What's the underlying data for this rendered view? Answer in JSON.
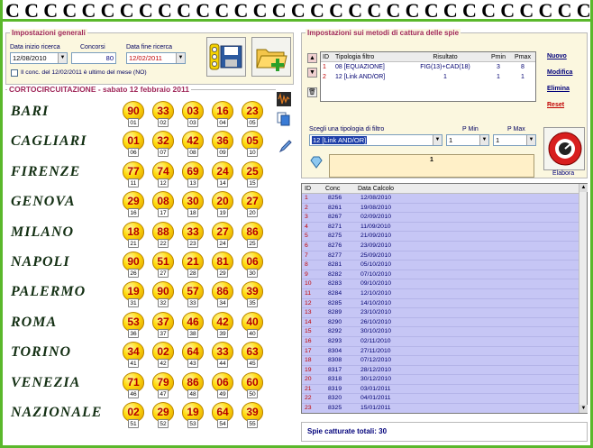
{
  "header": {
    "ring_glyph": "C"
  },
  "generali": {
    "title": "Impostazioni generali",
    "data_inizio_label": "Data inizio ricerca",
    "data_inizio_value": "12/08/2010",
    "concorsi_label": "Concorsi",
    "concorsi_value": "80",
    "data_fine_label": "Data fine ricerca",
    "data_fine_value": "12/02/2011",
    "checkbox_label": "Il conc. del 12/02/2011 è ultimo del mese (NO)"
  },
  "corto": {
    "title": "CORTOCIRCUITAZIONE - sabato 12 febbraio 2011",
    "wheels": [
      {
        "name": "BARI",
        "balls": [
          [
            "90",
            "01"
          ],
          [
            "33",
            "02"
          ],
          [
            "03",
            "03"
          ],
          [
            "16",
            "04"
          ],
          [
            "23",
            "05"
          ]
        ]
      },
      {
        "name": "CAGLIARI",
        "balls": [
          [
            "01",
            "06"
          ],
          [
            "32",
            "07"
          ],
          [
            "42",
            "08"
          ],
          [
            "36",
            "09"
          ],
          [
            "05",
            "10"
          ]
        ]
      },
      {
        "name": "FIRENZE",
        "balls": [
          [
            "77",
            "11"
          ],
          [
            "74",
            "12"
          ],
          [
            "69",
            "13"
          ],
          [
            "24",
            "14"
          ],
          [
            "25",
            "15"
          ]
        ]
      },
      {
        "name": "GENOVA",
        "balls": [
          [
            "29",
            "16"
          ],
          [
            "08",
            "17"
          ],
          [
            "30",
            "18"
          ],
          [
            "20",
            "19"
          ],
          [
            "27",
            "20"
          ]
        ]
      },
      {
        "name": "MILANO",
        "balls": [
          [
            "18",
            "21"
          ],
          [
            "88",
            "22"
          ],
          [
            "33",
            "23"
          ],
          [
            "27",
            "24"
          ],
          [
            "86",
            "25"
          ]
        ]
      },
      {
        "name": "NAPOLI",
        "balls": [
          [
            "90",
            "26"
          ],
          [
            "51",
            "27"
          ],
          [
            "21",
            "28"
          ],
          [
            "81",
            "29"
          ],
          [
            "06",
            "30"
          ]
        ]
      },
      {
        "name": "PALERMO",
        "balls": [
          [
            "19",
            "31"
          ],
          [
            "90",
            "32"
          ],
          [
            "57",
            "33"
          ],
          [
            "86",
            "34"
          ],
          [
            "39",
            "35"
          ]
        ]
      },
      {
        "name": "ROMA",
        "balls": [
          [
            "53",
            "36"
          ],
          [
            "37",
            "37"
          ],
          [
            "46",
            "38"
          ],
          [
            "42",
            "39"
          ],
          [
            "40",
            "40"
          ]
        ]
      },
      {
        "name": "TORINO",
        "balls": [
          [
            "34",
            "41"
          ],
          [
            "02",
            "42"
          ],
          [
            "64",
            "43"
          ],
          [
            "33",
            "44"
          ],
          [
            "63",
            "45"
          ]
        ]
      },
      {
        "name": "VENEZIA",
        "balls": [
          [
            "71",
            "46"
          ],
          [
            "79",
            "47"
          ],
          [
            "86",
            "48"
          ],
          [
            "06",
            "49"
          ],
          [
            "60",
            "50"
          ]
        ]
      },
      {
        "name": "NAZIONALE",
        "balls": [
          [
            "02",
            "51"
          ],
          [
            "29",
            "52"
          ],
          [
            "19",
            "53"
          ],
          [
            "64",
            "54"
          ],
          [
            "39",
            "55"
          ]
        ]
      }
    ]
  },
  "metodi": {
    "title": "Impostazioni sui metodi di cattura delle spie",
    "headers": {
      "id": "ID",
      "tipologia": "Tipologia filtro",
      "risultato": "Risultato",
      "pmin": "Pmin",
      "pmax": "Pmax"
    },
    "rows": [
      {
        "id": "1",
        "tipologia": "08 [EQUAZIONE]",
        "risultato": "FIG(13)+CAD(18)",
        "pmin": "3",
        "pmax": "8"
      },
      {
        "id": "2",
        "tipologia": "12 [Link AND/OR]",
        "risultato": "1",
        "pmin": "1",
        "pmax": "1"
      }
    ],
    "buttons": {
      "nuovo": "Nuovo",
      "modifica": "Modifica",
      "elimina": "Elimina",
      "reset": "Reset"
    },
    "scegli_label": "Scegli una tipologia di filtro",
    "pmin_label": "P Min",
    "pmax_label": "P Max",
    "filter_value": "12 [Link AND/OR]",
    "pmin_value": "1",
    "pmax_value": "1",
    "formula_value": "1",
    "elabora_label": "Elabora"
  },
  "results": {
    "headers": {
      "id": "ID",
      "conc": "Conc",
      "data": "Data Calcolo"
    },
    "rows": [
      [
        "1",
        "8256",
        "12/08/2010"
      ],
      [
        "2",
        "8261",
        "19/08/2010"
      ],
      [
        "3",
        "8267",
        "02/09/2010"
      ],
      [
        "4",
        "8271",
        "11/09/2010"
      ],
      [
        "5",
        "8275",
        "21/09/2010"
      ],
      [
        "6",
        "8276",
        "23/09/2010"
      ],
      [
        "7",
        "8277",
        "25/09/2010"
      ],
      [
        "8",
        "8281",
        "05/10/2010"
      ],
      [
        "9",
        "8282",
        "07/10/2010"
      ],
      [
        "10",
        "8283",
        "09/10/2010"
      ],
      [
        "11",
        "8284",
        "12/10/2010"
      ],
      [
        "12",
        "8285",
        "14/10/2010"
      ],
      [
        "13",
        "8289",
        "23/10/2010"
      ],
      [
        "14",
        "8290",
        "26/10/2010"
      ],
      [
        "15",
        "8292",
        "30/10/2010"
      ],
      [
        "16",
        "8293",
        "02/11/2010"
      ],
      [
        "17",
        "8304",
        "27/11/2010"
      ],
      [
        "18",
        "8308",
        "07/12/2010"
      ],
      [
        "19",
        "8317",
        "28/12/2010"
      ],
      [
        "20",
        "8318",
        "30/12/2010"
      ],
      [
        "21",
        "8319",
        "03/01/2011"
      ],
      [
        "22",
        "8320",
        "04/01/2011"
      ],
      [
        "23",
        "8325",
        "15/01/2011"
      ]
    ],
    "status": "Spie catturate totali: 30"
  }
}
